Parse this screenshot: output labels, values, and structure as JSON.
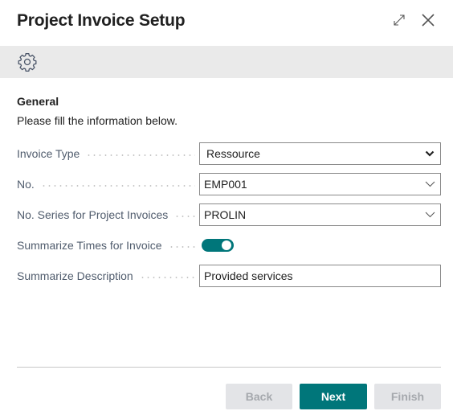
{
  "dialog": {
    "title": "Project Invoice Setup",
    "icons": {
      "expand": "expand-icon",
      "close": "close-icon",
      "settings": "gear-icon"
    }
  },
  "general": {
    "group_title": "General",
    "instructions": "Please fill the information below."
  },
  "fields": {
    "invoice_type": {
      "label": "Invoice Type",
      "value": "Ressource",
      "type": "select"
    },
    "no": {
      "label": "No.",
      "value": "EMP001",
      "type": "lookup"
    },
    "no_series": {
      "label": "No. Series for Project Invoices",
      "value": "PROLIN",
      "type": "lookup"
    },
    "summarize_times": {
      "label": "Summarize Times for Invoice",
      "value": true,
      "type": "toggle"
    },
    "summarize_description": {
      "label": "Summarize Description",
      "value": "Provided services",
      "type": "text"
    }
  },
  "footer": {
    "back_label": "Back",
    "next_label": "Next",
    "finish_label": "Finish"
  },
  "colors": {
    "accent": "#00767a",
    "action_bar": "#eaeaea",
    "disabled_button": "#e3e4e7",
    "label_text": "#505c6d"
  }
}
